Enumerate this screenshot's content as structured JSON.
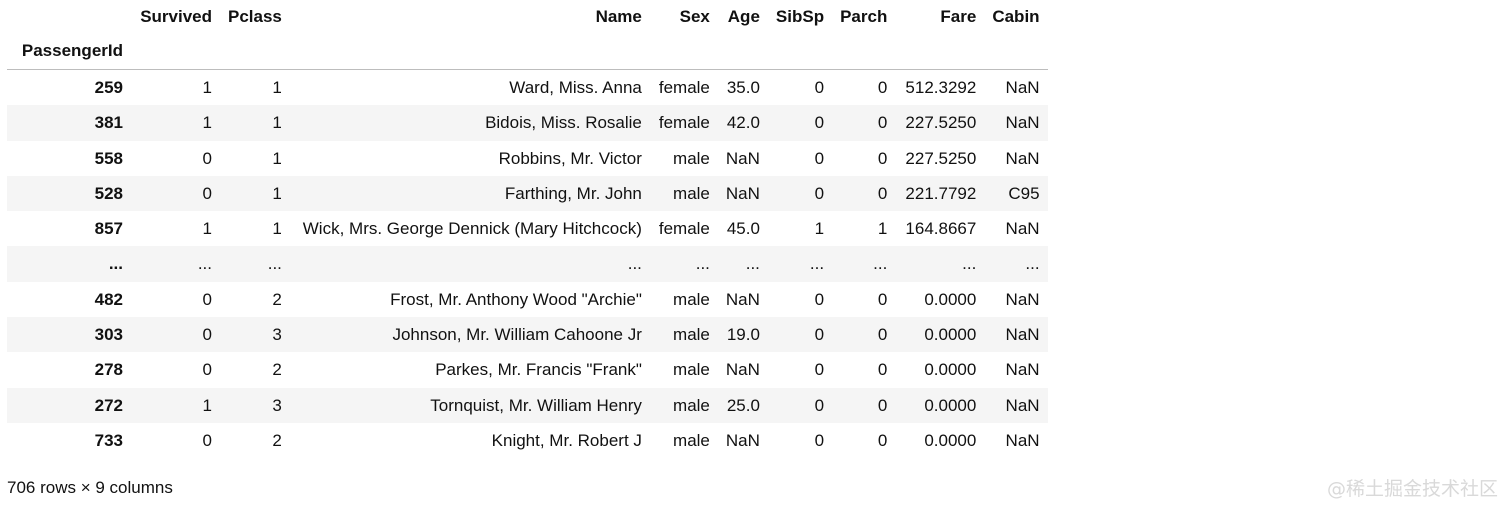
{
  "table": {
    "index_name": "PassengerId",
    "columns": [
      "Survived",
      "Pclass",
      "Name",
      "Sex",
      "Age",
      "SibSp",
      "Parch",
      "Fare",
      "Cabin"
    ],
    "rows": [
      {
        "idx": "259",
        "cells": [
          "1",
          "1",
          "Ward, Miss. Anna",
          "female",
          "35.0",
          "0",
          "0",
          "512.3292",
          "NaN"
        ]
      },
      {
        "idx": "381",
        "cells": [
          "1",
          "1",
          "Bidois, Miss. Rosalie",
          "female",
          "42.0",
          "0",
          "0",
          "227.5250",
          "NaN"
        ]
      },
      {
        "idx": "558",
        "cells": [
          "0",
          "1",
          "Robbins, Mr. Victor",
          "male",
          "NaN",
          "0",
          "0",
          "227.5250",
          "NaN"
        ]
      },
      {
        "idx": "528",
        "cells": [
          "0",
          "1",
          "Farthing, Mr. John",
          "male",
          "NaN",
          "0",
          "0",
          "221.7792",
          "C95"
        ]
      },
      {
        "idx": "857",
        "cells": [
          "1",
          "1",
          "Wick, Mrs. George Dennick (Mary Hitchcock)",
          "female",
          "45.0",
          "1",
          "1",
          "164.8667",
          "NaN"
        ]
      },
      {
        "idx": "...",
        "cells": [
          "...",
          "...",
          "...",
          "...",
          "...",
          "...",
          "...",
          "...",
          "..."
        ]
      },
      {
        "idx": "482",
        "cells": [
          "0",
          "2",
          "Frost, Mr. Anthony Wood \"Archie\"",
          "male",
          "NaN",
          "0",
          "0",
          "0.0000",
          "NaN"
        ]
      },
      {
        "idx": "303",
        "cells": [
          "0",
          "3",
          "Johnson, Mr. William Cahoone Jr",
          "male",
          "19.0",
          "0",
          "0",
          "0.0000",
          "NaN"
        ]
      },
      {
        "idx": "278",
        "cells": [
          "0",
          "2",
          "Parkes, Mr. Francis \"Frank\"",
          "male",
          "NaN",
          "0",
          "0",
          "0.0000",
          "NaN"
        ]
      },
      {
        "idx": "272",
        "cells": [
          "1",
          "3",
          "Tornquist, Mr. William Henry",
          "male",
          "25.0",
          "0",
          "0",
          "0.0000",
          "NaN"
        ]
      },
      {
        "idx": "733",
        "cells": [
          "0",
          "2",
          "Knight, Mr. Robert J",
          "male",
          "NaN",
          "0",
          "0",
          "0.0000",
          "NaN"
        ]
      }
    ]
  },
  "footer": {
    "shape_text": "706 rows × 9 columns"
  },
  "watermark": {
    "text": "@稀土掘金技术社区"
  },
  "colors": {
    "stripe": "#f5f5f5",
    "header_rule": "#bdbdbd",
    "watermark": "#d9d9d9"
  }
}
